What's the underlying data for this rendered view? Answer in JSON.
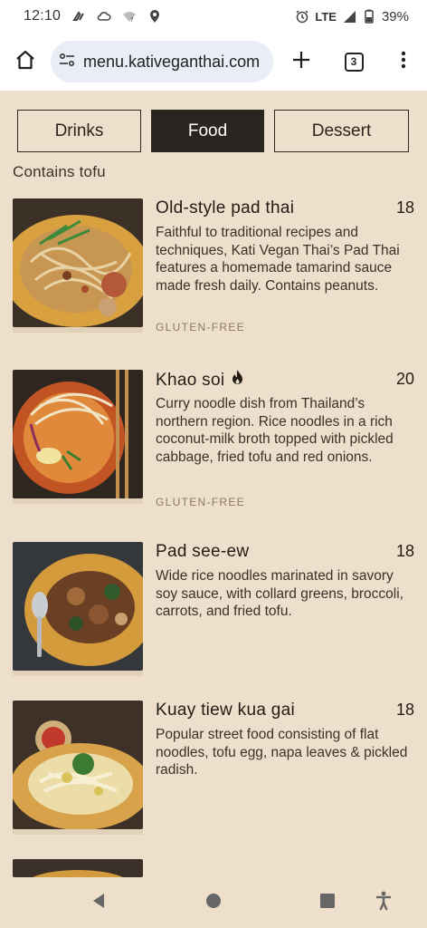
{
  "status_bar": {
    "time": "12:10",
    "network": "LTE",
    "battery": "39%",
    "icons": [
      "vpn-key-icon",
      "cloud-icon",
      "wifi-question-icon",
      "location-icon",
      "alarm-icon",
      "signal-icon",
      "battery-icon"
    ]
  },
  "browser": {
    "url": "menu.kativeganthai.com",
    "tab_count": "3",
    "icons": [
      "home-icon",
      "site-settings-icon",
      "plus-icon",
      "tabs-icon",
      "more-vert-icon"
    ]
  },
  "menu": {
    "tabs": [
      {
        "label": "Drinks",
        "active": false
      },
      {
        "label": "Food",
        "active": true
      },
      {
        "label": "Dessert",
        "active": false
      }
    ],
    "filter_note": "Contains tofu",
    "items": [
      {
        "name": "Old-style pad thai",
        "price": "18",
        "description": "Faithful to traditional recipes and techniques, Kati Vegan Thai’s Pad Thai features a homemade tamarind sauce made fresh daily. Contains peanuts.",
        "tag": "GLUTEN-FREE"
      },
      {
        "name": "Khao soi",
        "price": "20",
        "description": "Curry noodle dish from Thailand’s northern region. Rice noodles in a rich coconut-milk broth topped with pickled cabbage, fried tofu and red onions.",
        "tag": "GLUTEN-FREE",
        "spicy_icon": "flame-icon"
      },
      {
        "name": "Pad see-ew",
        "price": "18",
        "description": "Wide rice noodles marinated in savory soy sauce, with collard greens, broccoli, carrots, and fried tofu."
      },
      {
        "name": "Kuay tiew kua gai",
        "price": "18",
        "description": "Popular street food consisting of flat noodles, tofu egg, napa leaves & pickled radish."
      }
    ]
  },
  "nav_bar": {
    "icons": [
      "back-icon",
      "home-circle-icon",
      "recents-icon",
      "accessibility-icon"
    ]
  },
  "colors": {
    "page_bg": "#eddfcb",
    "active_tab_bg": "#2a2520",
    "tag_color": "#8b7a64",
    "url_bar_bg": "#e9eef6"
  }
}
